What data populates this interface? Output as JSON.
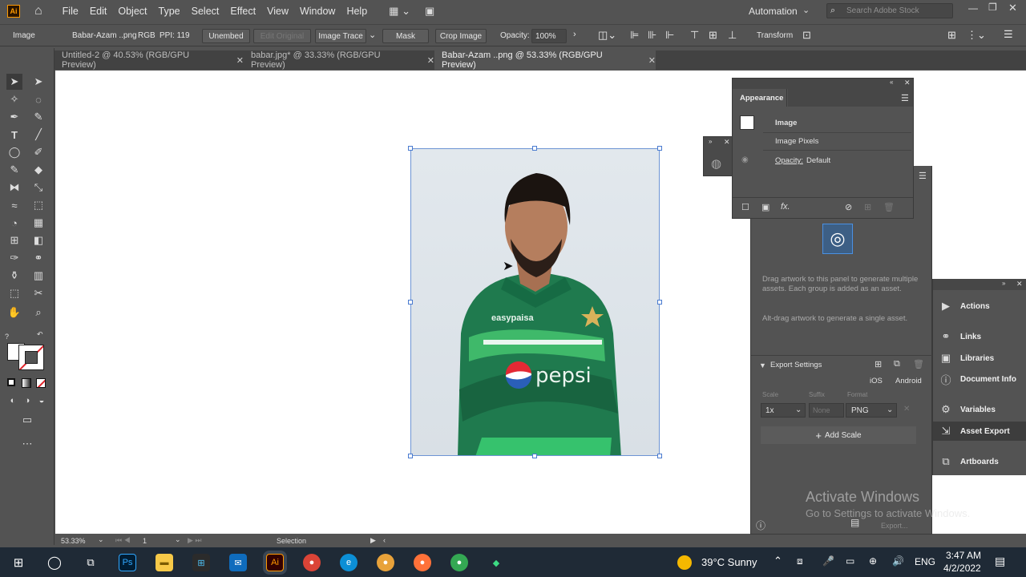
{
  "menubar": {
    "items": [
      "File",
      "Edit",
      "Object",
      "Type",
      "Select",
      "Effect",
      "View",
      "Window",
      "Help"
    ],
    "workspace": "Automation",
    "search_placeholder": "Search Adobe Stock"
  },
  "control_bar": {
    "selection_type": "Image",
    "file_name": "Babar-Azam ..png",
    "color_mode": "RGB",
    "ppi": "PPI: 119",
    "unembed": "Unembed",
    "edit_original": "Edit Original",
    "image_trace": "Image Trace",
    "mask": "Mask",
    "crop_image": "Crop Image",
    "opacity_label": "Opacity:",
    "opacity_value": "100%",
    "transform": "Transform"
  },
  "tabs": [
    {
      "label": "Untitled-2 @ 40.53% (RGB/GPU Preview)",
      "active": false
    },
    {
      "label": "babar.jpg* @ 33.33% (RGB/GPU Preview)",
      "active": false
    },
    {
      "label": "Babar-Azam ..png @ 53.33% (RGB/GPU Preview)",
      "active": true
    }
  ],
  "appearance_panel": {
    "title": "Appearance",
    "object": "Image",
    "sub": "Image Pixels",
    "opacity_label": "Opacity:",
    "opacity_value": "Default",
    "fx": "fx."
  },
  "asset_export": {
    "drag_text": "Drag artwork to this panel to generate multiple assets. Each group is added as an asset.",
    "alt_text": "Alt-drag artwork to generate a single asset.",
    "export_settings": "Export Settings",
    "ios": "iOS",
    "android": "Android",
    "scale_label": "Scale",
    "suffix_label": "Suffix",
    "format_label": "Format",
    "scale_value": "1x",
    "suffix_placeholder": "None",
    "format_value": "PNG",
    "add_scale": "Add Scale",
    "export": "Export..."
  },
  "side_panels": [
    "Actions",
    "Links",
    "Libraries",
    "Document Info",
    "Variables",
    "Asset Export",
    "Artboards"
  ],
  "status_bar": {
    "zoom": "53.33%",
    "artboard": "1",
    "tool": "Selection"
  },
  "watermark": {
    "line1": "Activate Windows",
    "line2": "Go to Settings to activate Windows."
  },
  "photo": {
    "sponsor_1": "easypaisa",
    "sponsor_2": "pepsi"
  },
  "taskbar": {
    "weather": "39°C  Sunny",
    "lang": "ENG",
    "time": "3:47 AM",
    "date": "4/2/2022"
  }
}
